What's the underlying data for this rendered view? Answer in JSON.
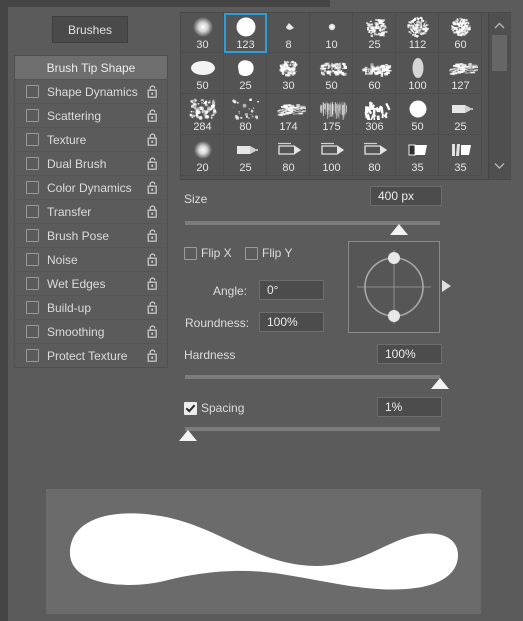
{
  "panel": {
    "tab_label": "Brushes",
    "accent_color": "#2e9fd6",
    "background_color": "#5b5b5b"
  },
  "options_list": {
    "header_label": "Brush Tip Shape",
    "items": [
      {
        "label": "Shape Dynamics",
        "checked": false,
        "locked": false
      },
      {
        "label": "Scattering",
        "checked": false,
        "locked": false
      },
      {
        "label": "Texture",
        "checked": false,
        "locked": true
      },
      {
        "label": "Dual Brush",
        "checked": false,
        "locked": false
      },
      {
        "label": "Color Dynamics",
        "checked": false,
        "locked": false
      },
      {
        "label": "Transfer",
        "checked": false,
        "locked": true
      },
      {
        "label": "Brush Pose",
        "checked": false,
        "locked": false
      },
      {
        "label": "Noise",
        "checked": false,
        "locked": false
      },
      {
        "label": "Wet Edges",
        "checked": false,
        "locked": false
      },
      {
        "label": "Build-up",
        "checked": false,
        "locked": false
      },
      {
        "label": "Smoothing",
        "checked": false,
        "locked": false
      },
      {
        "label": "Protect Texture",
        "checked": false,
        "locked": false
      }
    ]
  },
  "brush_grid": {
    "selected_index": 1,
    "scroll_up_icon": "chevron-up-icon",
    "scroll_down_icon": "chevron-down-icon",
    "presets": [
      {
        "size": "30",
        "shape": "soft-round"
      },
      {
        "size": "123",
        "shape": "hard-round"
      },
      {
        "size": "8",
        "shape": "tiny-spatter"
      },
      {
        "size": "10",
        "shape": "small-round"
      },
      {
        "size": "25",
        "shape": "chalk-rough"
      },
      {
        "size": "112",
        "shape": "scatter-dense"
      },
      {
        "size": "60",
        "shape": "stipple-ball"
      },
      {
        "size": "50",
        "shape": "soft-ellipse"
      },
      {
        "size": "25",
        "shape": "blob-round"
      },
      {
        "size": "30",
        "shape": "grain-round"
      },
      {
        "size": "50",
        "shape": "chalk-streak"
      },
      {
        "size": "60",
        "shape": "chalk-streak-wide"
      },
      {
        "size": "100",
        "shape": "oval-flat"
      },
      {
        "size": "127",
        "shape": "dry-scratch"
      },
      {
        "size": "284",
        "shape": "spatter-fine"
      },
      {
        "size": "80",
        "shape": "spatter-sparse"
      },
      {
        "size": "174",
        "shape": "smear-streak"
      },
      {
        "size": "175",
        "shape": "hair-comb"
      },
      {
        "size": "306",
        "shape": "grass-clump"
      },
      {
        "size": "50",
        "shape": "hard-round-large"
      },
      {
        "size": "25",
        "shape": "marker-flat"
      },
      {
        "size": "20",
        "shape": "soft-glow"
      },
      {
        "size": "25",
        "shape": "marker-flat-2"
      },
      {
        "size": "80",
        "shape": "pencil-tip"
      },
      {
        "size": "100",
        "shape": "pencil-tip-2"
      },
      {
        "size": "80",
        "shape": "pencil-tip-3"
      },
      {
        "size": "35",
        "shape": "chisel-flat"
      },
      {
        "size": "35",
        "shape": "chisel-angled"
      }
    ]
  },
  "controls": {
    "size": {
      "label": "Size",
      "value": "400 px",
      "slider_percent": 84
    },
    "flip_x": {
      "label": "Flip X",
      "checked": false
    },
    "flip_y": {
      "label": "Flip Y",
      "checked": false
    },
    "angle": {
      "label": "Angle:",
      "value": "0°"
    },
    "roundness": {
      "label": "Roundness:",
      "value": "100%"
    },
    "hardness": {
      "label": "Hardness",
      "value": "100%",
      "slider_percent": 100
    },
    "spacing": {
      "label": "Spacing",
      "value": "1%",
      "checked": true,
      "slider_percent": 1
    }
  },
  "preview": {
    "stroke_color": "#ffffff",
    "background_color": "#6b6b6b"
  }
}
